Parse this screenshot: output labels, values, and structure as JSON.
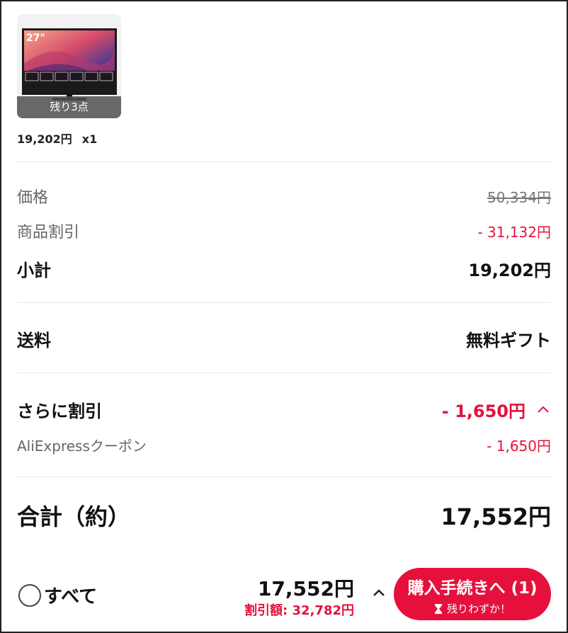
{
  "product": {
    "screen_size_label": "27\"",
    "stock_badge": "残り3点",
    "price": "19,202円",
    "quantity": "x1"
  },
  "summary": {
    "price_label": "価格",
    "price_value": "50,334円",
    "product_discount_label": "商品割引",
    "product_discount_value": "- 31,132円",
    "subtotal_label": "小計",
    "subtotal_value": "19,202円",
    "shipping_label": "送料",
    "shipping_value": "無料ギフト",
    "extra_discount_label": "さらに割引",
    "extra_discount_value": "- 1,650円",
    "coupon_label": "AliExpressクーポン",
    "coupon_value": "- 1,650円",
    "total_label": "合計（約）",
    "total_value": "17,552円"
  },
  "bottom_bar": {
    "select_all_label": "すべて",
    "total": "17,552円",
    "discount_amount": "割引額: 32,782円",
    "checkout_label": "購入手続きへ (1)",
    "checkout_sub": "残りわずか！"
  },
  "colors": {
    "accent_red": "#e5113c",
    "muted_text": "#666666",
    "divider": "#e8e8e8"
  },
  "icons": [
    "monitor-product-image",
    "chevron-up-icon",
    "radio-unchecked-icon",
    "hourglass-icon"
  ]
}
